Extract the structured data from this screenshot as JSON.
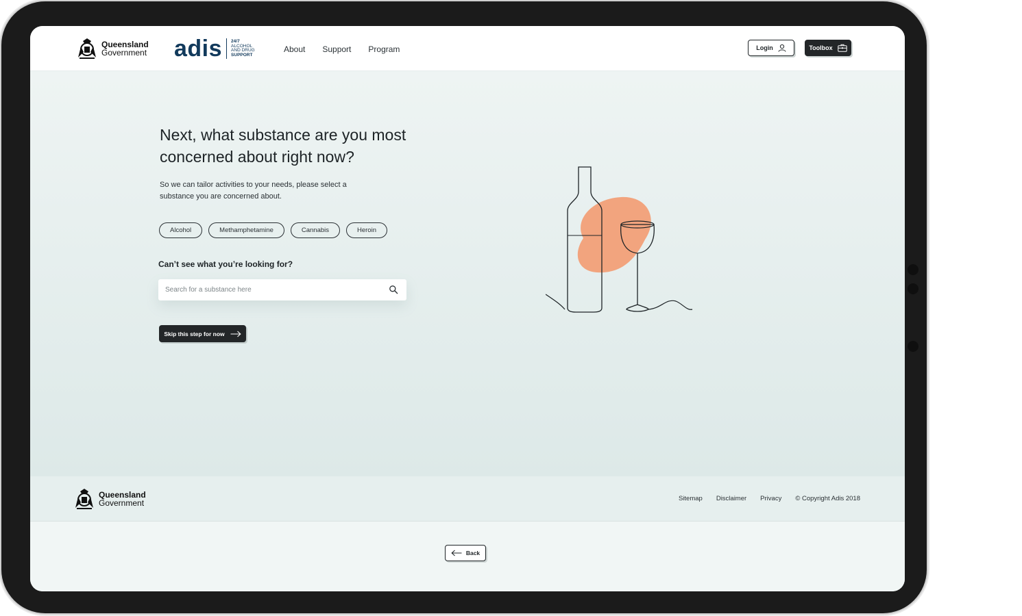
{
  "header": {
    "gov_logo": {
      "line1": "Queensland",
      "line2": "Government"
    },
    "brand": {
      "word": "adis",
      "tag_line1": "24/7",
      "tag_line2": "ALCOHOL",
      "tag_line3": "AND DRUG",
      "tag_line4": "SUPPORT"
    },
    "nav": [
      {
        "label": "About"
      },
      {
        "label": "Support"
      },
      {
        "label": "Program"
      }
    ],
    "login_label": "Login",
    "toolbox_label": "Toolbox"
  },
  "main": {
    "title": "Next, what substance are you most concerned about right now?",
    "subtitle": "So we can tailor activities to your needs, please select a substance you are concerned about.",
    "substances": [
      {
        "label": "Alcohol"
      },
      {
        "label": "Methamphetamine"
      },
      {
        "label": "Cannabis"
      },
      {
        "label": "Heroin"
      }
    ],
    "lookup_label": "Can’t see what you’re looking for?",
    "search_placeholder": "Search for a substance here",
    "search_value": "",
    "skip_label": "Skip this step for now"
  },
  "footer": {
    "gov_logo": {
      "line1": "Queensland",
      "line2": "Government"
    },
    "links": [
      {
        "label": "Sitemap"
      },
      {
        "label": "Disclaimer"
      },
      {
        "label": "Privacy"
      }
    ],
    "copyright": "© Copyright Adis 2018"
  },
  "back_label": "Back",
  "colors": {
    "accent_blob": "#f2a47e",
    "brand_navy": "#123a5c",
    "dark_button": "#232628",
    "hero_bg": "#e5efee"
  },
  "icons": {
    "login": "user-icon",
    "toolbox": "toolbox-icon",
    "search": "search-icon",
    "skip": "arrow-right-icon",
    "back": "arrow-left-icon"
  }
}
